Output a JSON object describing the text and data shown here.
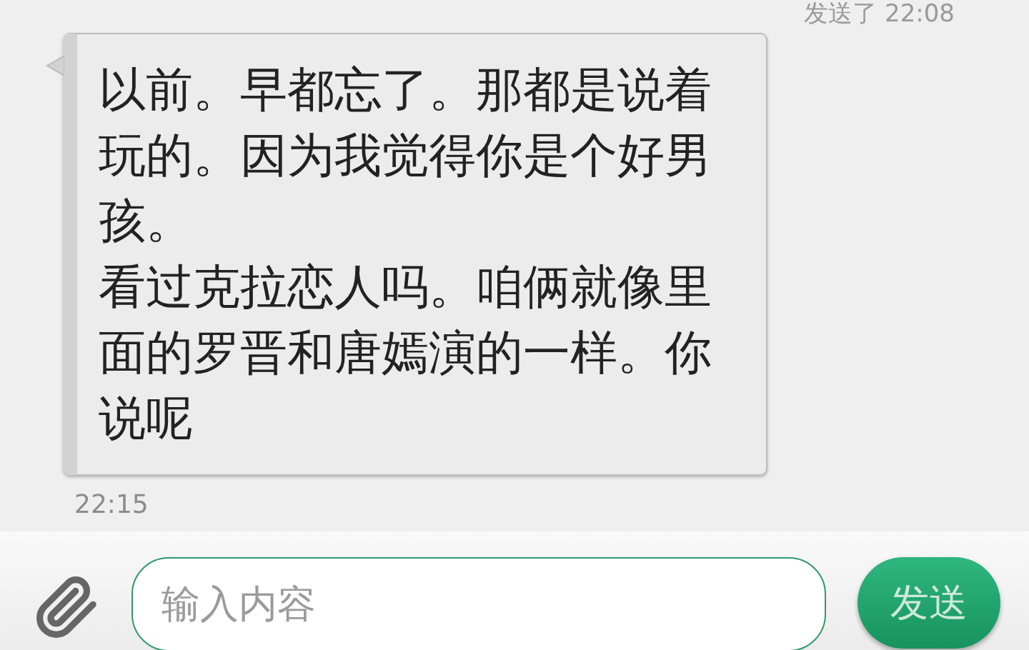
{
  "previous_message": {
    "status": "发送了 22:08"
  },
  "message": {
    "paragraphs": [
      "以前。早都忘了。那都是说着玩的。因为我觉得你是个好男孩。",
      "看过克拉恋人吗。咱俩就像里面的罗晋和唐嫣演的一样。你说呢"
    ],
    "time": "22:15"
  },
  "composer": {
    "placeholder": "输入内容",
    "send_label": "发送"
  }
}
